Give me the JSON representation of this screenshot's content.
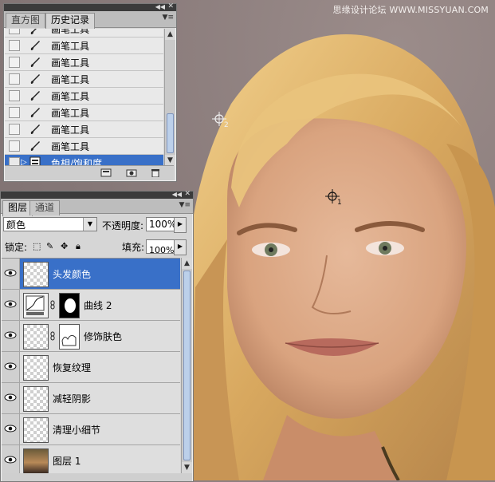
{
  "watermark": "思缘设计论坛 WWW.MISSYUAN.COM",
  "history_panel": {
    "tabs": [
      {
        "label": "直方图",
        "active": false
      },
      {
        "label": "历史记录",
        "active": true
      }
    ],
    "items": [
      {
        "label": "画笔工具",
        "icon": "brush-icon"
      },
      {
        "label": "画笔工具",
        "icon": "brush-icon"
      },
      {
        "label": "画笔工具",
        "icon": "brush-icon"
      },
      {
        "label": "画笔工具",
        "icon": "brush-icon"
      },
      {
        "label": "画笔工具",
        "icon": "brush-icon"
      },
      {
        "label": "画笔工具",
        "icon": "brush-icon"
      },
      {
        "label": "画笔工具",
        "icon": "brush-icon"
      },
      {
        "label": "画笔工具",
        "icon": "brush-icon"
      },
      {
        "label": "色相/饱和度",
        "icon": "adjustment-icon",
        "selected": true
      }
    ],
    "footer_icons": [
      "new-document-from-state-icon",
      "snapshot-camera-icon",
      "trash-icon"
    ]
  },
  "layers_panel": {
    "tabs": [
      {
        "label": "图层",
        "active": true
      },
      {
        "label": "通道",
        "active": false
      }
    ],
    "blend_mode": "颜色",
    "opacity_label": "不透明度:",
    "opacity_value": "100%",
    "lock_label": "锁定:",
    "fill_label": "填充:",
    "fill_value": "100%",
    "layers": [
      {
        "name": "头发颜色",
        "thumb": "transparent",
        "selected": true
      },
      {
        "name": "曲线 2",
        "thumb": "curves",
        "mask": "black"
      },
      {
        "name": "修饰肤色",
        "thumb": "transparent",
        "mask": "white"
      },
      {
        "name": "恢复纹理",
        "thumb": "transparent"
      },
      {
        "name": "减轻阴影",
        "thumb": "transparent"
      },
      {
        "name": "清理小细节",
        "thumb": "transparent"
      },
      {
        "name": "图层 1",
        "thumb": "photo"
      }
    ]
  },
  "canvas": {
    "sampler_1_label": "1",
    "sampler_2_label": "2"
  },
  "colors": {
    "selection": "#3970c8",
    "panel_bg": "#d6d6d6",
    "canvas_bg": "#867878"
  }
}
